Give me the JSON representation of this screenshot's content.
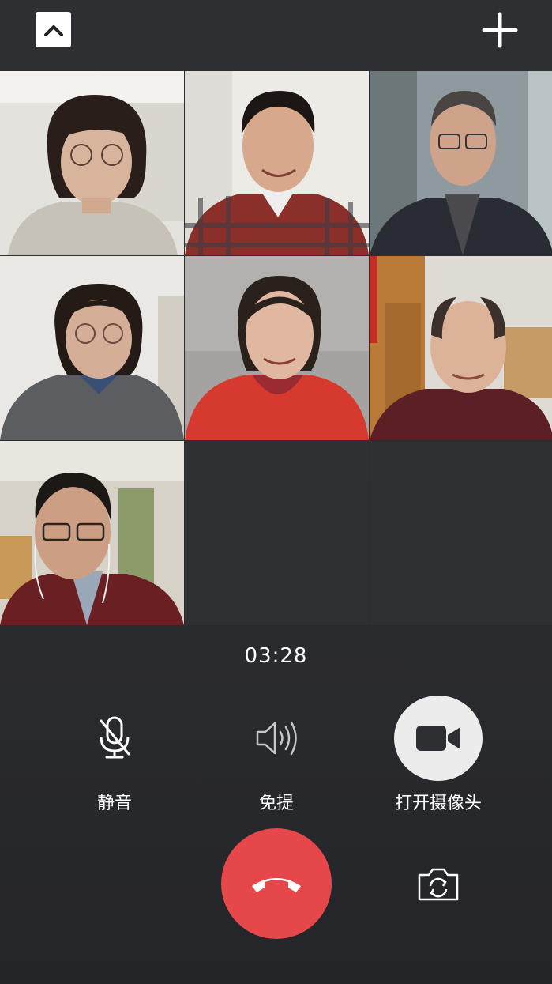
{
  "call": {
    "timer": "03:28"
  },
  "controls": {
    "mute_label": "静音",
    "speaker_label": "免提",
    "camera_label": "打开摄像头"
  },
  "colors": {
    "background": "#2b2c30",
    "hangup": "#e5474a",
    "camera_button": "#ececec",
    "text": "#ffffff"
  },
  "icons": {
    "collapse": "chevron-up-icon",
    "add": "plus-icon",
    "mute": "microphone-off-icon",
    "speaker": "speaker-icon",
    "camera": "video-camera-icon",
    "hangup": "phone-hangup-icon",
    "flip": "camera-switch-icon"
  }
}
